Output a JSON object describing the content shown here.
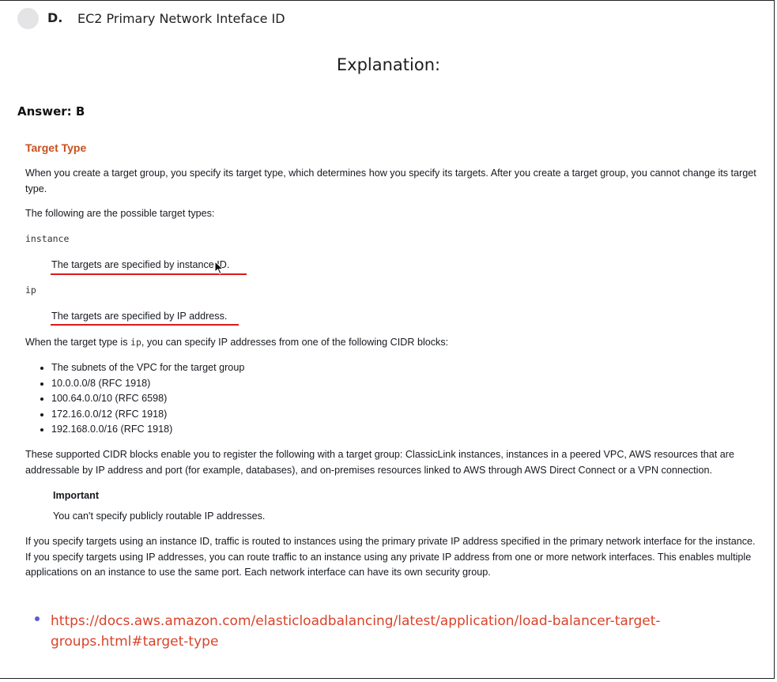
{
  "option": {
    "letter": "D.",
    "text": "EC2 Primary Network Inteface ID"
  },
  "explanation_title": "Explanation:",
  "answer": "Answer: B",
  "doc": {
    "heading": "Target Type",
    "intro": "When you create a target group, you specify its target type, which determines how you specify its targets. After you create a target group, you cannot change its target type.",
    "possible_types": "The following are the possible target types:",
    "instance_code": "instance",
    "instance_desc": "The targets are specified by instance ID.",
    "ip_code": "ip",
    "ip_desc": "The targets are specified by IP address.",
    "ip_note_prefix": "When the target type is ",
    "ip_note_code": "ip",
    "ip_note_suffix": ", you can specify IP addresses from one of the following CIDR blocks:",
    "cidr_list": [
      "The subnets of the VPC for the target group",
      "10.0.0.0/8 (RFC 1918)",
      "100.64.0.0/10 (RFC 6598)",
      "172.16.0.0/12 (RFC 1918)",
      "192.168.0.0/16 (RFC 1918)"
    ],
    "supported": "These supported CIDR blocks enable you to register the following with a target group: ClassicLink instances, instances in a peered VPC, AWS resources that are addressable by IP address and port (for example, databases), and on-premises resources linked to AWS through AWS Direct Connect or a VPN connection.",
    "important_title": "Important",
    "important_text": "You can't specify publicly routable IP addresses.",
    "final": "If you specify targets using an instance ID, traffic is routed to instances using the primary private IP address specified in the primary network interface for the instance. If you specify targets using IP addresses, you can route traffic to an instance using any private IP address from one or more network interfaces. This enables multiple applications on an instance to use the same port. Each network interface can have its own security group."
  },
  "reference_link": "https://docs.aws.amazon.com/elasticloadbalancing/latest/application/load-balancer-target-groups.html#target-type",
  "colors": {
    "heading": "#c7511f",
    "underline": "#d81a1a",
    "link": "#d9432b",
    "bullet": "#5b5bd6",
    "radio": "#e4e4e7"
  }
}
